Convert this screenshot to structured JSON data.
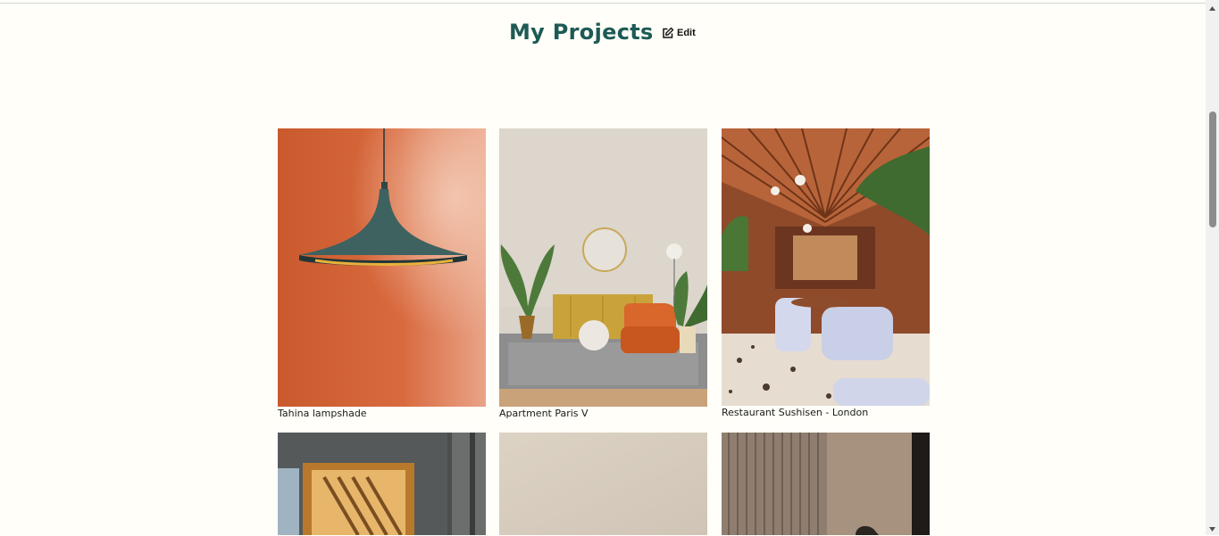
{
  "header": {
    "title": "My Projects",
    "edit_label": "Edit"
  },
  "projects": [
    {
      "caption": "Tahina lampshade"
    },
    {
      "caption": "Apartment Paris V"
    },
    {
      "caption": "Restaurant Sushisen - London"
    },
    {
      "caption": ""
    },
    {
      "caption": ""
    },
    {
      "caption": ""
    }
  ],
  "icons": {
    "edit": "edit-icon",
    "scroll_up": "triangle-up-icon",
    "scroll_down": "triangle-down-icon"
  },
  "colors": {
    "background": "#fffef8",
    "title": "#1e5a55",
    "scroll_thumb": "#8c8c8c"
  },
  "scroll": {
    "position_fraction": 0.21
  }
}
